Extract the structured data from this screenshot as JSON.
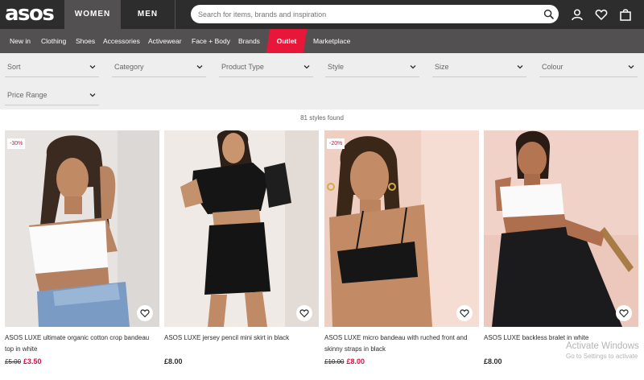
{
  "header": {
    "logo": "asos",
    "gender_tabs": [
      "WOMEN",
      "MEN"
    ],
    "search_placeholder": "Search for items, brands and inspiration"
  },
  "nav": {
    "items": [
      "New in",
      "Clothing",
      "Shoes",
      "Accessories",
      "Activewear",
      "Face + Body",
      "Brands",
      "Outlet",
      "Marketplace"
    ],
    "highlight": "Outlet",
    "highlight_color": "#e8173a"
  },
  "filters": [
    "Sort",
    "Category",
    "Product Type",
    "Style",
    "Size",
    "Colour",
    "Price Range"
  ],
  "results": {
    "count_text": "81 styles found"
  },
  "products": [
    {
      "title": "ASOS LUXE ultimate organic cotton crop bandeau top in white",
      "badge": "-30%",
      "price_was": "£5.00",
      "price_now": "£3.50"
    },
    {
      "title": "ASOS LUXE jersey pencil mini skirt in black",
      "badge": "",
      "price_was": "",
      "price_now": "£8.00"
    },
    {
      "title": "ASOS LUXE micro bandeau with ruched front and skinny straps in black",
      "badge": "-20%",
      "price_was": "£10.00",
      "price_now": "£8.00"
    },
    {
      "title": "ASOS LUXE backless bralet in white",
      "badge": "",
      "price_was": "",
      "price_now": "£8.00"
    }
  ],
  "colors": {
    "header_bg": "#2d2d2d",
    "nav_bg": "#525050",
    "sale_red": "#d01345",
    "filter_bg": "#eeeeee"
  },
  "watermark": {
    "title": "Activate Windows",
    "subtitle": "Go to Settings to activate"
  }
}
